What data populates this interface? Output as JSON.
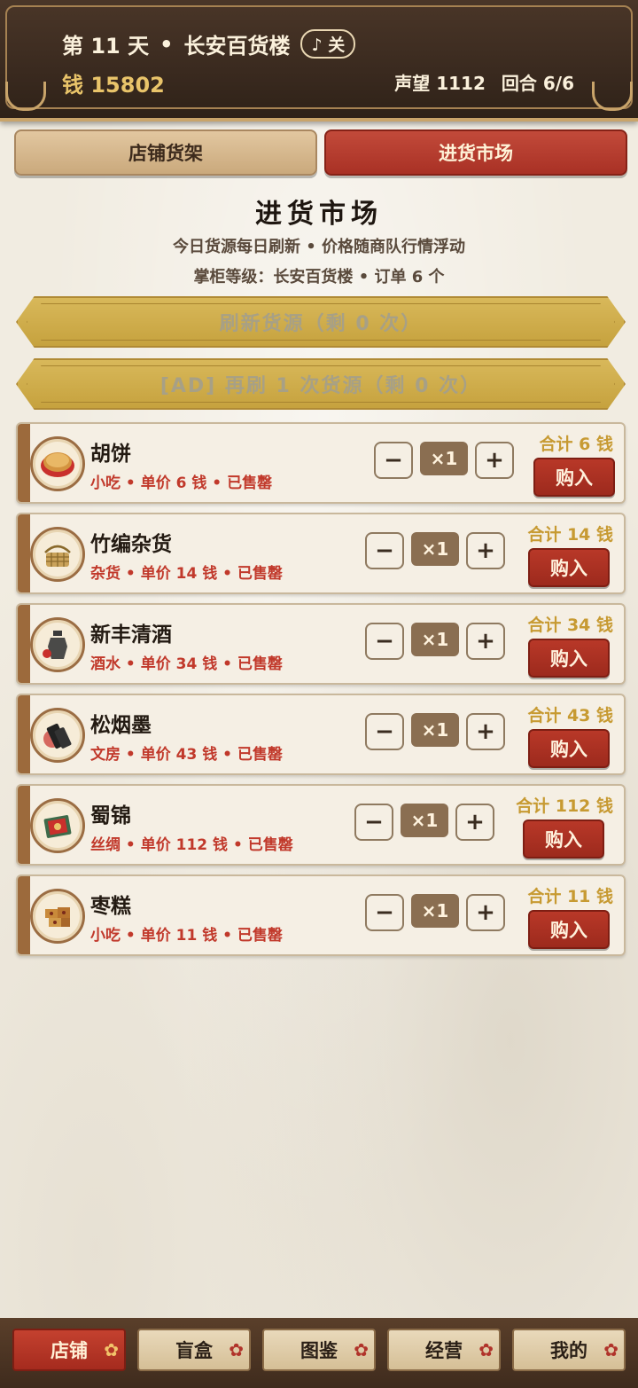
{
  "header": {
    "day": "第 11 天",
    "separator": "•",
    "shop_name": "长安百货楼",
    "music_label": "♪ 关",
    "money": "钱 15802",
    "reputation": "声望 1112",
    "round": "回合 6/6"
  },
  "tabs": {
    "shop_shelf": "店铺货架",
    "market": "进货市场"
  },
  "market": {
    "title": "进货市场",
    "subtitle1": "今日货源每日刷新 • 价格随商队行情浮动",
    "subtitle2": "掌柜等级：长安百货楼 • 订单 6 个",
    "refresh_label": "刷新货源（剩 0 次）",
    "ad_refresh_label": "[AD] 再刷 1 次货源（剩 0 次）"
  },
  "items": [
    {
      "name": "胡饼",
      "meta": "小吃 • 单价 6 钱 • 已售罄",
      "qty": "×1",
      "minus": "−",
      "plus": "+",
      "total": "合计 6 钱",
      "buy": "购入",
      "icon": "flatbread-icon"
    },
    {
      "name": "竹编杂货",
      "meta": "杂货 • 单价 14 钱 • 已售罄",
      "qty": "×1",
      "minus": "−",
      "plus": "+",
      "total": "合计 14 钱",
      "buy": "购入",
      "icon": "bamboo-basket-icon"
    },
    {
      "name": "新丰清酒",
      "meta": "酒水 • 单价 34 钱 • 已售罄",
      "qty": "×1",
      "minus": "−",
      "plus": "+",
      "total": "合计 34 钱",
      "buy": "购入",
      "icon": "wine-jug-icon"
    },
    {
      "name": "松烟墨",
      "meta": "文房 • 单价 43 钱 • 已售罄",
      "qty": "×1",
      "minus": "−",
      "plus": "+",
      "total": "合计 43 钱",
      "buy": "购入",
      "icon": "ink-stick-icon"
    },
    {
      "name": "蜀锦",
      "meta": "丝绸 • 单价 112 钱 • 已售罄",
      "qty": "×1",
      "minus": "−",
      "plus": "+",
      "total": "合计 112 钱",
      "buy": "购入",
      "icon": "brocade-icon"
    },
    {
      "name": "枣糕",
      "meta": "小吃 • 单价 11 钱 • 已售罄",
      "qty": "×1",
      "minus": "−",
      "plus": "+",
      "total": "合计 11 钱",
      "buy": "购入",
      "icon": "date-cake-icon"
    }
  ],
  "nav": [
    "店铺",
    "盲盒",
    "图鉴",
    "经营",
    "我的"
  ],
  "colors": {
    "accent_red": "#b83828",
    "gold": "#c79a32",
    "wood": "#3a2a1f"
  }
}
